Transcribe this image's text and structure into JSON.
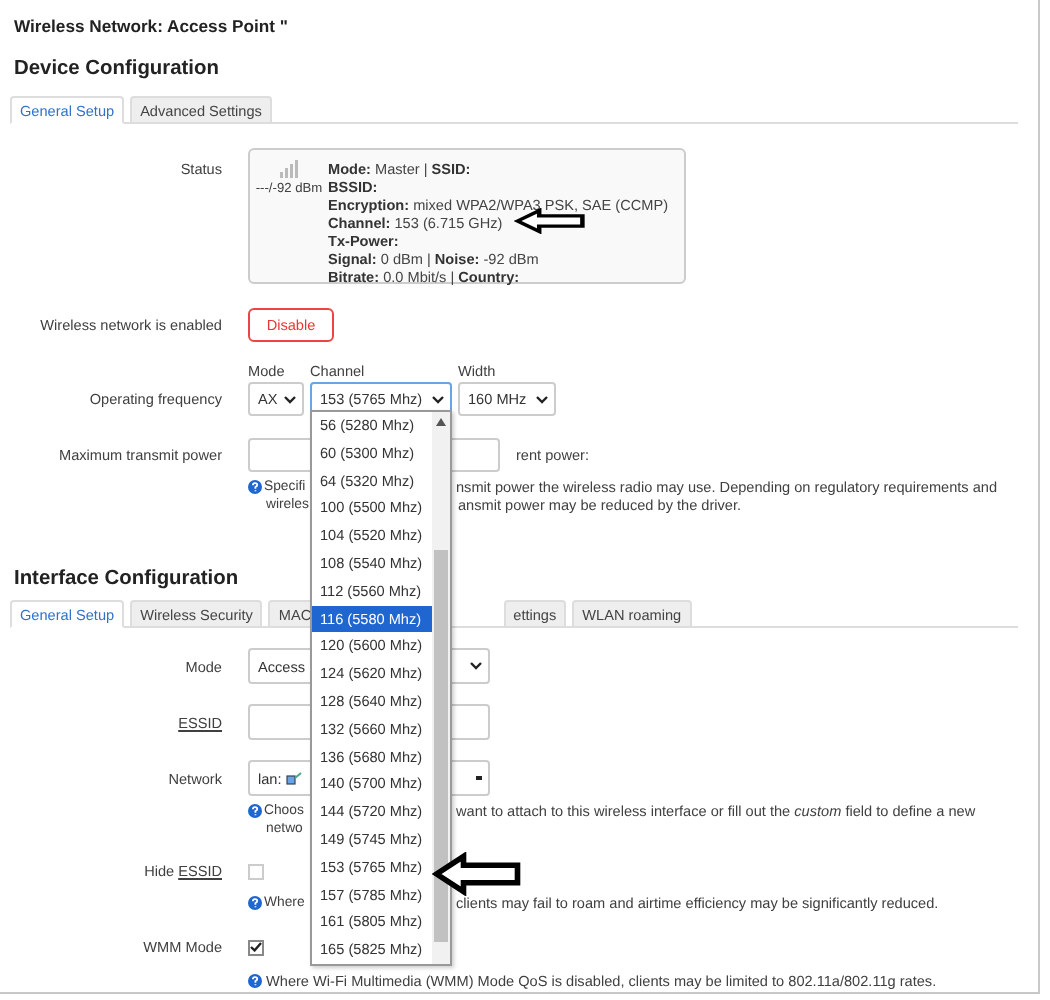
{
  "page_title": "Wireless Network: Access Point \"",
  "device": {
    "heading": "Device Configuration",
    "tabs": [
      {
        "label": "General Setup",
        "selected": true
      },
      {
        "label": "Advanced Settings",
        "selected": false
      }
    ],
    "status": {
      "label": "Status",
      "signal_reading": "---/-92 dBm",
      "lines": [
        "**Mode:** Master | **SSID:**",
        "**BSSID:**",
        "**Encryption:** mixed WPA2/WPA3 PSK, SAE (CCMP)",
        "**Channel:** 153 (6.715 GHz)",
        "**Tx-Power:**",
        "**Signal:** 0 dBm | **Noise:** -92 dBm",
        "**Bitrate:** 0.0 Mbit/s | **Country:**"
      ]
    },
    "enabled": {
      "label": "Wireless network is enabled",
      "button": "Disable"
    },
    "frequency": {
      "label": "Operating frequency",
      "mode": {
        "caption": "Mode",
        "value": "AX"
      },
      "channel": {
        "caption": "Channel",
        "value": "153 (5765 Mhz)",
        "open": true
      },
      "width": {
        "caption": "Width",
        "value": "160 MHz"
      }
    },
    "tx_power": {
      "label": "Maximum transmit power",
      "after": "rent power:",
      "help": [
        {
          "left": "Specifi",
          "right": "nsmit power the wireless radio may use. Depending on regulatory requirements and"
        },
        {
          "left": "wireles",
          "right": "ansmit power may be reduced by the driver."
        }
      ]
    }
  },
  "interface": {
    "heading": "Interface Configuration",
    "tabs": [
      {
        "label": "General Setup",
        "selected": true,
        "kind": "whole"
      },
      {
        "label": "Wireless Security",
        "selected": false,
        "kind": "whole"
      },
      {
        "label": "MAC",
        "selected": false,
        "kind": "head"
      },
      {
        "label": "ettings",
        "selected": false,
        "kind": "tail"
      },
      {
        "label": "WLAN roaming",
        "selected": false,
        "kind": "whole"
      }
    ],
    "mode": {
      "label": "Mode",
      "value": "Access"
    },
    "essid": {
      "abbr": "ESSID"
    },
    "network": {
      "label": "Network",
      "value": "lan:",
      "help": [
        {
          "left": "Choos",
          "right": "want to attach to this wireless interface or fill out the *custom* field to define a new"
        },
        {
          "left": "netwo"
        }
      ]
    },
    "hide_essid": {
      "label": "Hide",
      "abbr": "ESSID",
      "checked": false,
      "help": {
        "left": "Where",
        "right": "clients may fail to roam and airtime efficiency may be significantly reduced."
      }
    },
    "wmm": {
      "label": "WMM Mode",
      "checked": true,
      "help": "Where Wi-Fi Multimedia (WMM) Mode QoS is disabled, clients may be limited to 802.11a/802.11g rates."
    }
  },
  "channel_options": [
    {
      "label": "56 (5280 Mhz)",
      "selected": false
    },
    {
      "label": "60 (5300 Mhz)",
      "selected": false
    },
    {
      "label": "64 (5320 Mhz)",
      "selected": false
    },
    {
      "label": "100 (5500 Mhz)",
      "selected": false
    },
    {
      "label": "104 (5520 Mhz)",
      "selected": false
    },
    {
      "label": "108 (5540 Mhz)",
      "selected": false
    },
    {
      "label": "112 (5560 Mhz)",
      "selected": false
    },
    {
      "label": "116 (5580 Mhz)",
      "selected": true
    },
    {
      "label": "120 (5600 Mhz)",
      "selected": false
    },
    {
      "label": "124 (5620 Mhz)",
      "selected": false
    },
    {
      "label": "128 (5640 Mhz)",
      "selected": false
    },
    {
      "label": "132 (5660 Mhz)",
      "selected": false
    },
    {
      "label": "136 (5680 Mhz)",
      "selected": false
    },
    {
      "label": "140 (5700 Mhz)",
      "selected": false
    },
    {
      "label": "144 (5720 Mhz)",
      "selected": false
    },
    {
      "label": "149 (5745 Mhz)",
      "selected": false
    },
    {
      "label": "153 (5765 Mhz)",
      "selected": false
    },
    {
      "label": "157 (5785 Mhz)",
      "selected": false
    },
    {
      "label": "161 (5805 Mhz)",
      "selected": false
    },
    {
      "label": "165 (5825 Mhz)",
      "selected": false
    }
  ]
}
